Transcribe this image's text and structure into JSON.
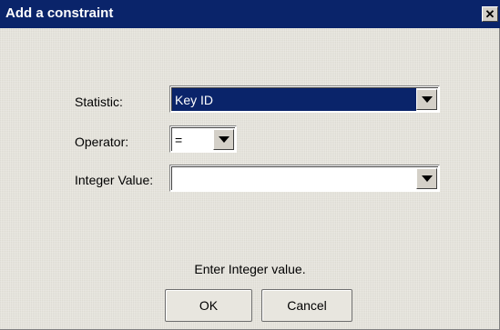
{
  "window": {
    "title": "Add a constraint",
    "close_glyph": "✕"
  },
  "form": {
    "statistic": {
      "label": "Statistic:",
      "value": "Key ID"
    },
    "operator": {
      "label": "Operator:",
      "value": "="
    },
    "integer_value": {
      "label": "Integer Value:",
      "value": ""
    }
  },
  "status_text": "Enter Integer value.",
  "buttons": {
    "ok_label": "OK",
    "cancel_label": "Cancel"
  },
  "colors": {
    "title_bar": "#0a246a",
    "selection": "#0a246a",
    "dialog_bg": "#e6e4dc"
  }
}
